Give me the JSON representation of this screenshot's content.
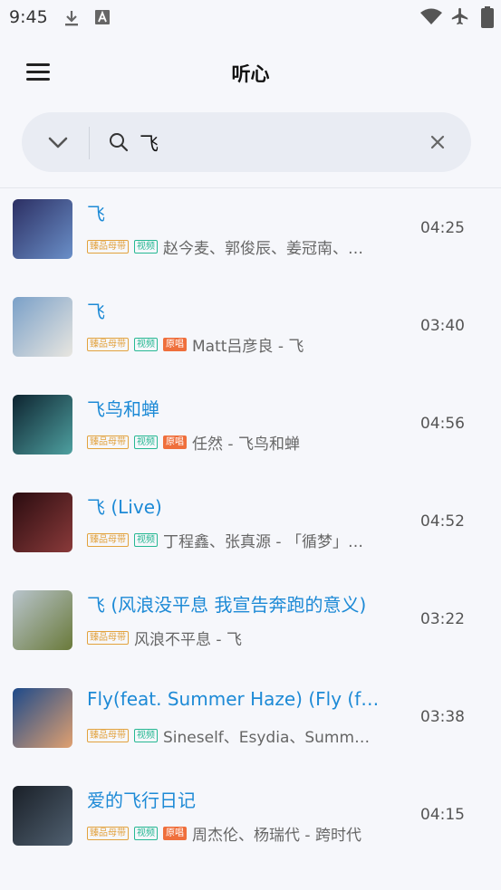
{
  "status_bar": {
    "time": "9:45",
    "left_icons": [
      "download-icon",
      "a-box-icon"
    ],
    "right_icons": [
      "wifi-icon",
      "airplane-icon",
      "battery-icon"
    ]
  },
  "header": {
    "title": "听心",
    "menu_icon": "hamburger-menu-icon"
  },
  "search": {
    "value": "飞",
    "dropdown_icon": "chevron-down-icon",
    "search_icon": "search-icon",
    "clear_icon": "close-icon"
  },
  "songs": [
    {
      "title": "飞",
      "tags": [
        "臻品母带",
        "视频"
      ],
      "artist": "赵今麦、郭俊辰、姜冠南、…",
      "duration": "04:25",
      "cover": [
        "#2c2f63",
        "#6a8fc8"
      ]
    },
    {
      "title": "飞",
      "tags": [
        "臻品母带",
        "视频",
        "原唱"
      ],
      "artist": "Matt吕彦良 - 飞",
      "duration": "03:40",
      "cover": [
        "#7aa0c8",
        "#e8e6e0"
      ]
    },
    {
      "title": "飞鸟和蝉",
      "tags": [
        "臻品母带",
        "视频",
        "原唱"
      ],
      "artist": "任然 - 飞鸟和蝉",
      "duration": "04:56",
      "cover": [
        "#0e2430",
        "#4ea0a0"
      ]
    },
    {
      "title": "飞 (Live)",
      "tags": [
        "臻品母带",
        "视频"
      ],
      "artist": "丁程鑫、张真源 - 「循梦」…",
      "duration": "04:52",
      "cover": [
        "#2a0c10",
        "#8a3a3a"
      ]
    },
    {
      "title": "飞 (风浪没平息 我宣告奔跑的意义)",
      "tags": [
        "臻品母带"
      ],
      "artist": "风浪不平息 - 飞",
      "duration": "03:22",
      "cover": [
        "#b8c4cc",
        "#6a7a3a"
      ]
    },
    {
      "title": "Fly(feat. Summer Haze) (Fly (feat…",
      "tags": [
        "臻品母带",
        "视频"
      ],
      "artist": "Sineself、Esydia、Summe…",
      "duration": "03:38",
      "cover": [
        "#1e4a8a",
        "#e0a070"
      ]
    },
    {
      "title": "爱的飞行日记",
      "tags": [
        "臻品母带",
        "视频",
        "原唱"
      ],
      "artist": "周杰伦、杨瑞代 - 跨时代",
      "duration": "04:15",
      "cover": [
        "#1a2028",
        "#506070"
      ]
    }
  ],
  "colors": {
    "accent_blue": "#1d8ad6",
    "tag_master": "#e2a23d",
    "tag_video": "#27b893",
    "tag_original": "#ef6f3c"
  }
}
